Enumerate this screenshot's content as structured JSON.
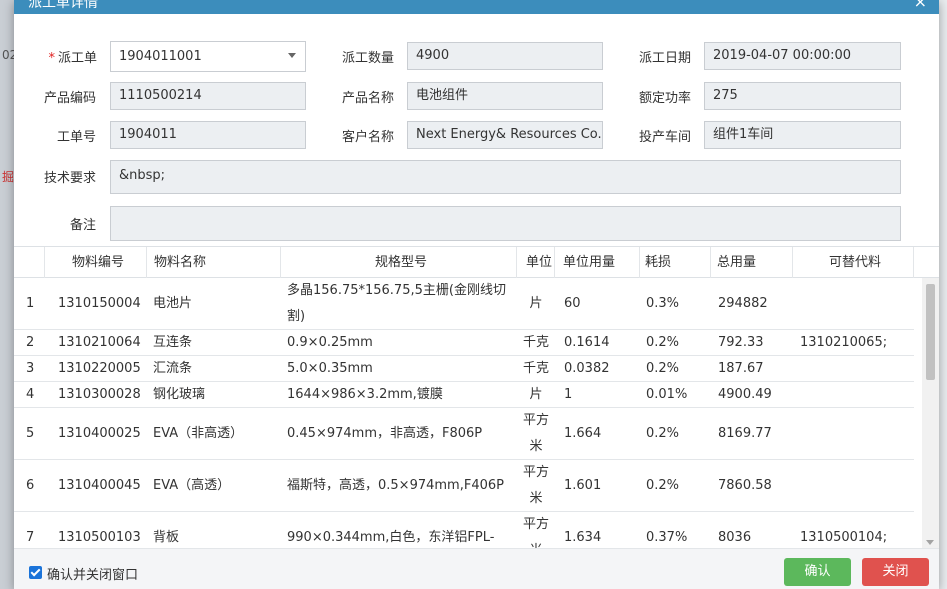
{
  "background": {
    "fragments": [
      "02",
      "掘"
    ]
  },
  "dialog": {
    "title": "派工单详情",
    "close_icon": "close-icon"
  },
  "form": {
    "dispatch_no": {
      "label": "派工单",
      "value": "1904011001"
    },
    "dispatch_qty": {
      "label": "派工数量",
      "value": "4900"
    },
    "dispatch_date": {
      "label": "派工日期",
      "value": "2019-04-07 00:00:00"
    },
    "product_code": {
      "label": "产品编码",
      "value": "1110500214"
    },
    "product_name": {
      "label": "产品名称",
      "value": "电池组件"
    },
    "rated_power": {
      "label": "额定功率",
      "value": "275"
    },
    "work_order_no": {
      "label": "工单号",
      "value": "1904011"
    },
    "customer_name": {
      "label": "客户名称",
      "value": "Next Energy& Resources Co.,LTD"
    },
    "workshop": {
      "label": "投产车间",
      "value": "组件1车间"
    },
    "tech_requirement": {
      "label": "技术要求",
      "value": "&nbsp;"
    },
    "remark": {
      "label": "备注",
      "value": ""
    }
  },
  "table": {
    "headers": [
      "",
      "物料编号",
      "物料名称",
      "规格型号",
      "单位",
      "单位用量",
      "耗损",
      "总用量",
      "可替代料"
    ],
    "rows": [
      {
        "idx": "1",
        "code": "1310150004",
        "name": "电池片",
        "spec": "多晶156.75*156.75,5主栅(金刚线切割)",
        "unit": "片",
        "unit_qty": "60",
        "loss": "0.3%",
        "total": "294882",
        "alt": ""
      },
      {
        "idx": "2",
        "code": "1310210064",
        "name": "互连条",
        "spec": "0.9×0.25mm",
        "unit": "千克",
        "unit_qty": "0.1614",
        "loss": "0.2%",
        "total": "792.33",
        "alt": "1310210065;"
      },
      {
        "idx": "3",
        "code": "1310220005",
        "name": "汇流条",
        "spec": "5.0×0.35mm",
        "unit": "千克",
        "unit_qty": "0.0382",
        "loss": "0.2%",
        "total": "187.67",
        "alt": ""
      },
      {
        "idx": "4",
        "code": "1310300028",
        "name": "钢化玻璃",
        "spec": "1644×986×3.2mm,镀膜",
        "unit": "片",
        "unit_qty": "1",
        "loss": "0.01%",
        "total": "4900.49",
        "alt": ""
      },
      {
        "idx": "5",
        "code": "1310400025",
        "name": "EVA（非高透）",
        "spec": "0.45×974mm，非高透，F806P",
        "unit": "平方米",
        "unit_qty": "1.664",
        "loss": "0.2%",
        "total": "8169.77",
        "alt": ""
      },
      {
        "idx": "6",
        "code": "1310400045",
        "name": "EVA（高透）",
        "spec": "福斯特，高透，0.5×974mm,F406P",
        "unit": "平方米",
        "unit_qty": "1.601",
        "loss": "0.2%",
        "total": "7860.58",
        "alt": ""
      },
      {
        "idx": "7",
        "code": "1310500103",
        "name": "背板",
        "spec": "990×0.344mm,白色，东洋铝FPL-",
        "unit": "平方米",
        "unit_qty": "1.634",
        "loss": "0.37%",
        "total": "8036",
        "alt": "1310500104;"
      }
    ]
  },
  "footer": {
    "checkbox_label": "确认并关闭窗口",
    "checkbox_checked": true,
    "confirm_label": "确认",
    "close_label": "关闭"
  },
  "colors": {
    "titlebar": "#3c8dbc",
    "confirm": "#5cb85c",
    "close": "#e0524e",
    "checkbox": "#1a73d9"
  }
}
